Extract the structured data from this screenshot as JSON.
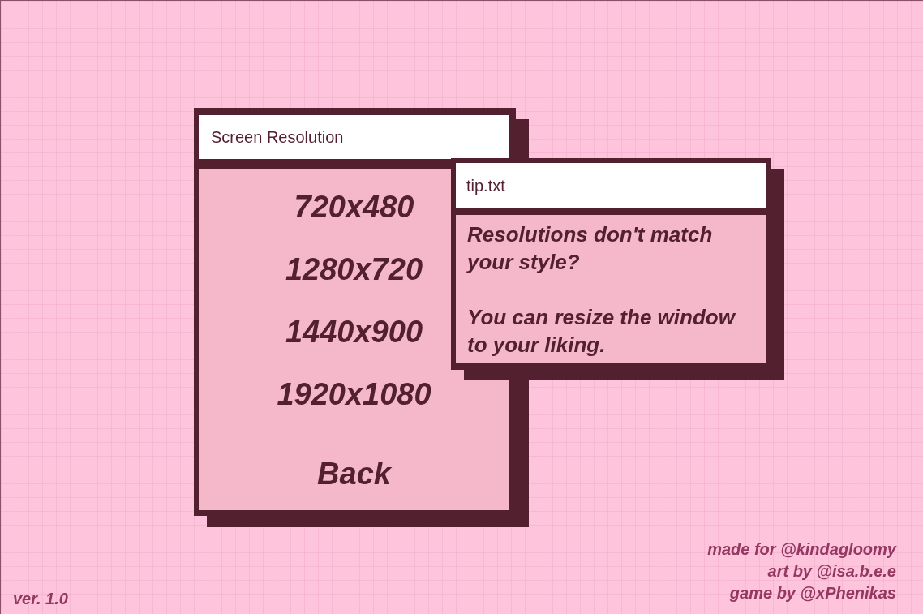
{
  "resolution_window": {
    "title": "Screen Resolution",
    "options": [
      "720x480",
      "1280x720",
      "1440x900",
      "1920x1080"
    ],
    "back_button": "Back"
  },
  "tip_window": {
    "title": "tip.txt",
    "paragraphs": [
      "Resolutions don't match your style?",
      "You can resize the window to your liking."
    ]
  },
  "version": "ver. 1.0",
  "credits": [
    "made for @kindagloomy",
    "art by @isa.b.e.e",
    "game by @xPhenikas"
  ]
}
